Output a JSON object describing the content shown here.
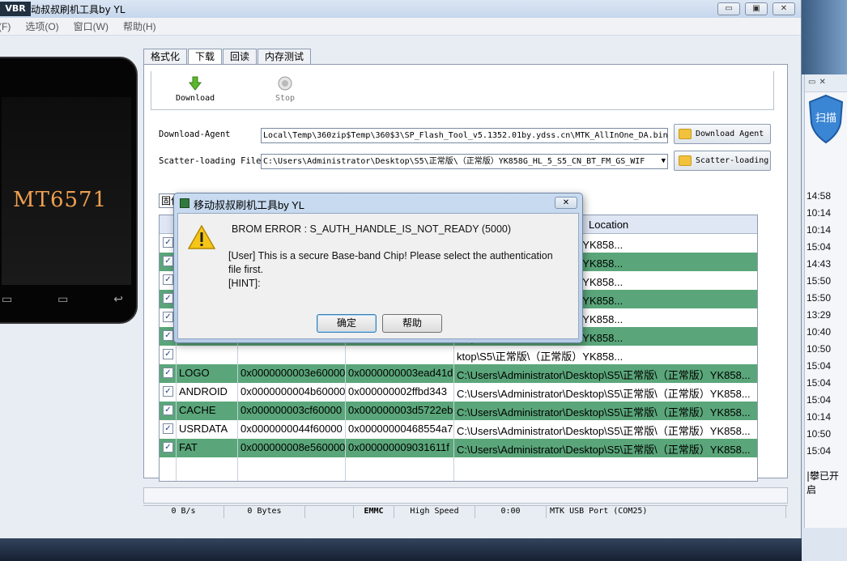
{
  "window": {
    "title": "动叔叔刷机工具by YL",
    "logo_text": "VBR",
    "minimize": "▭",
    "restore": "▣",
    "close": "✕"
  },
  "menu": [
    "文件(F)",
    "选项(O)",
    "窗口(W)",
    "帮助(H)"
  ],
  "phone": {
    "chip_label": "MT6571"
  },
  "tabs": [
    "格式化",
    "下载",
    "回读",
    "内存测试"
  ],
  "active_tab": 1,
  "toolbar": {
    "download_label": "Download",
    "stop_label": "Stop"
  },
  "download_agent": {
    "label": "Download-Agent",
    "path": "Local\\Temp\\360zip$Temp\\360$3\\SP_Flash_Tool_v5.1352.01by.ydss.cn\\MTK_AllInOne_DA.bin",
    "button": "Download Agent"
  },
  "scatter": {
    "label": "Scatter-loading File",
    "path": "C:\\Users\\Administrator\\Desktop\\S5\\正常版\\（正常版）YK858G_HL_5_S5_CN_BT_FM_GS_WIF",
    "button": "Scatter-loading"
  },
  "mode_select": "固件升级",
  "grid": {
    "header_location": "Location",
    "rows": [
      {
        "name": "",
        "begin": "",
        "end": "",
        "location": "ktop\\S5\\正常版\\（正常版）YK858...",
        "style": "w"
      },
      {
        "name": "",
        "begin": "",
        "end": "",
        "location": "ktop\\S5\\正常版\\（正常版）YK858...",
        "style": "g"
      },
      {
        "name": "",
        "begin": "",
        "end": "",
        "location": "ktop\\S5\\正常版\\（正常版）YK858...",
        "style": "w"
      },
      {
        "name": "",
        "begin": "",
        "end": "",
        "location": "ktop\\S5\\正常版\\（正常版）YK858...",
        "style": "g"
      },
      {
        "name": "",
        "begin": "",
        "end": "",
        "location": "ktop\\S5\\正常版\\（正常版）YK858...",
        "style": "w"
      },
      {
        "name": "",
        "begin": "",
        "end": "",
        "location": "ktop\\S5\\正常版\\（正常版）YK858...",
        "style": "g"
      },
      {
        "name": "",
        "begin": "",
        "end": "",
        "location": "ktop\\S5\\正常版\\（正常版）YK858...",
        "style": "w"
      },
      {
        "name": "LOGO",
        "begin": "0x0000000003e60000",
        "end": "0x0000000003ead41d",
        "location": "C:\\Users\\Administrator\\Desktop\\S5\\正常版\\（正常版）YK858...",
        "style": "g"
      },
      {
        "name": "ANDROID",
        "begin": "0x0000000004b60000",
        "end": "0x000000002ffbd343",
        "location": "C:\\Users\\Administrator\\Desktop\\S5\\正常版\\（正常版）YK858...",
        "style": "w"
      },
      {
        "name": "CACHE",
        "begin": "0x000000003cf60000",
        "end": "0x000000003d5722eb",
        "location": "C:\\Users\\Administrator\\Desktop\\S5\\正常版\\（正常版）YK858...",
        "style": "g"
      },
      {
        "name": "USRDATA",
        "begin": "0x0000000044f60000",
        "end": "0x00000000468554a7",
        "location": "C:\\Users\\Administrator\\Desktop\\S5\\正常版\\（正常版）YK858...",
        "style": "w"
      },
      {
        "name": "FAT",
        "begin": "0x000000008e560000",
        "end": "0x000000009031611f",
        "location": "C:\\Users\\Administrator\\Desktop\\S5\\正常版\\（正常版）YK858...",
        "style": "g"
      }
    ]
  },
  "statusbar": {
    "speed": "0 B/s",
    "bytes": "0 Bytes",
    "storage": "EMMC",
    "usb_speed": "High Speed",
    "time": "0:00",
    "port": "MTK USB Port (COM25)"
  },
  "dialog": {
    "title": "移动叔叔刷机工具by YL",
    "close": "✕",
    "error_line": "BROM ERROR : S_AUTH_HANDLE_IS_NOT_READY (5000)",
    "user_line1": "[User] This is a secure Base-band Chip! Please select the authentication",
    "user_line2": "file first.",
    "hint_line": "[HINT]:",
    "ok_button": "确定",
    "help_button": "帮助"
  },
  "side_panel": {
    "scan_label": "扫描",
    "times": [
      "14:58",
      "10:14",
      "10:14",
      "15:04",
      "14:43",
      "15:50",
      "15:50",
      "13:29",
      "10:40",
      "10:50",
      "15:04",
      "15:04",
      "15:04",
      "10:14",
      "10:50",
      "15:04"
    ],
    "footer": "|攀已开启"
  },
  "colors": {
    "row_green": "#5aa67a",
    "header_blue": "#dfe6f4",
    "chip_orange": "#f0a050"
  }
}
